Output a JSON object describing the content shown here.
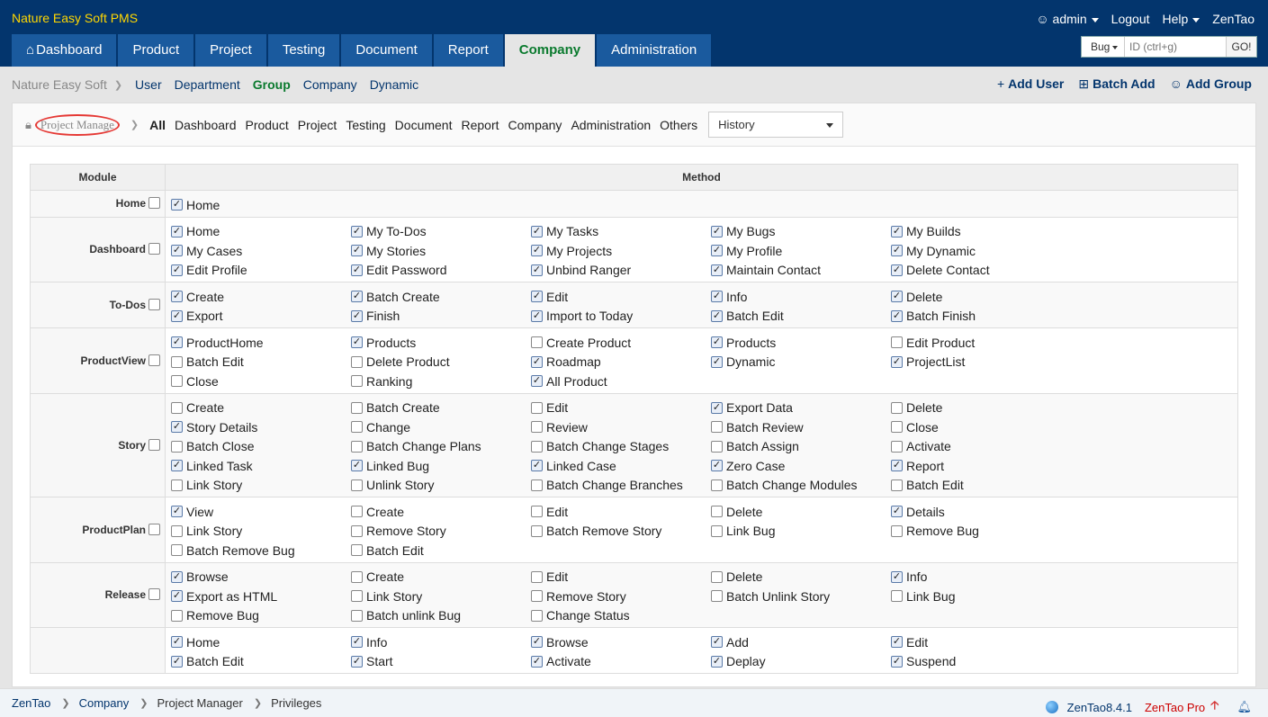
{
  "header": {
    "brand": "Nature Easy Soft PMS",
    "user": "admin",
    "logout": "Logout",
    "help": "Help",
    "zentao": "ZenTao"
  },
  "mainnav": [
    {
      "label": "Dashboard",
      "icon": "home-icon"
    },
    {
      "label": "Product"
    },
    {
      "label": "Project"
    },
    {
      "label": "Testing"
    },
    {
      "label": "Document"
    },
    {
      "label": "Report"
    },
    {
      "label": "Company",
      "active": true
    },
    {
      "label": "Administration"
    }
  ],
  "search": {
    "type": "Bug",
    "placeholder": "ID (ctrl+g)",
    "go": "GO!"
  },
  "subnav": {
    "crumb": "Nature Easy Soft",
    "links": [
      "User",
      "Department",
      "Group",
      "Company",
      "Dynamic"
    ],
    "active": "Group"
  },
  "actions": {
    "add_user": "Add User",
    "batch_add": "Batch Add",
    "add_group": "Add Group"
  },
  "filter": {
    "group_name": "Project Manage",
    "items": [
      "All",
      "Dashboard",
      "Product",
      "Project",
      "Testing",
      "Document",
      "Report",
      "Company",
      "Administration",
      "Others"
    ],
    "selected": "All",
    "history": "History"
  },
  "table": {
    "module_header": "Module",
    "method_header": "Method",
    "rows": [
      {
        "module": "Home",
        "items": [
          [
            "Home",
            true
          ]
        ]
      },
      {
        "module": "Dashboard",
        "items": [
          [
            "Home",
            true
          ],
          [
            "My To-Dos",
            true
          ],
          [
            "My Tasks",
            true
          ],
          [
            "My Bugs",
            true
          ],
          [
            "My Builds",
            true
          ],
          [
            "My Cases",
            true
          ],
          [
            "My Stories",
            true
          ],
          [
            "My Projects",
            true
          ],
          [
            "My Profile",
            true
          ],
          [
            "My Dynamic",
            true
          ],
          [
            "Edit Profile",
            true
          ],
          [
            "Edit Password",
            true
          ],
          [
            "Unbind Ranger",
            true
          ],
          [
            "Maintain Contact",
            true
          ],
          [
            "Delete Contact",
            true
          ]
        ]
      },
      {
        "module": "To-Dos",
        "items": [
          [
            "Create",
            true
          ],
          [
            "Batch Create",
            true
          ],
          [
            "Edit",
            true
          ],
          [
            "Info",
            true
          ],
          [
            "Delete",
            true
          ],
          [
            "Export",
            true
          ],
          [
            "Finish",
            true
          ],
          [
            "Import to Today",
            true
          ],
          [
            "Batch Edit",
            true
          ],
          [
            "Batch Finish",
            true
          ]
        ]
      },
      {
        "module": "ProductView",
        "items": [
          [
            "ProductHome",
            true
          ],
          [
            "Products",
            true
          ],
          [
            "Create Product",
            false
          ],
          [
            "Products",
            true
          ],
          [
            "Edit Product",
            false
          ],
          [
            "Batch Edit",
            false
          ],
          [
            "Delete Product",
            false
          ],
          [
            "Roadmap",
            true
          ],
          [
            "Dynamic",
            true
          ],
          [
            "ProjectList",
            true
          ],
          [
            "Close",
            false
          ],
          [
            "Ranking",
            false
          ],
          [
            "All Product",
            true
          ]
        ]
      },
      {
        "module": "Story",
        "items": [
          [
            "Create",
            false
          ],
          [
            "Batch Create",
            false
          ],
          [
            "Edit",
            false
          ],
          [
            "Export Data",
            true
          ],
          [
            "Delete",
            false
          ],
          [
            "Story Details",
            true
          ],
          [
            "Change",
            false
          ],
          [
            "Review",
            false
          ],
          [
            "Batch Review",
            false
          ],
          [
            "Close",
            false
          ],
          [
            "Batch Close",
            false
          ],
          [
            "Batch Change Plans",
            false
          ],
          [
            "Batch Change Stages",
            false
          ],
          [
            "Batch Assign",
            false
          ],
          [
            "Activate",
            false
          ],
          [
            "Linked Task",
            true
          ],
          [
            "Linked Bug",
            true
          ],
          [
            "Linked Case",
            true
          ],
          [
            "Zero Case",
            true
          ],
          [
            "Report",
            true
          ],
          [
            "Link Story",
            false
          ],
          [
            "Unlink Story",
            false
          ],
          [
            "Batch Change Branches",
            false
          ],
          [
            "Batch Change Modules",
            false
          ],
          [
            "Batch Edit",
            false
          ]
        ]
      },
      {
        "module": "ProductPlan",
        "items": [
          [
            "View",
            true
          ],
          [
            "Create",
            false
          ],
          [
            "Edit",
            false
          ],
          [
            "Delete",
            false
          ],
          [
            "Details",
            true
          ],
          [
            "Link Story",
            false
          ],
          [
            "Remove Story",
            false
          ],
          [
            "Batch Remove Story",
            false
          ],
          [
            "Link Bug",
            false
          ],
          [
            "Remove Bug",
            false
          ],
          [
            "Batch Remove Bug",
            false
          ],
          [
            "Batch Edit",
            false
          ]
        ]
      },
      {
        "module": "Release",
        "items": [
          [
            "Browse",
            true
          ],
          [
            "Create",
            false
          ],
          [
            "Edit",
            false
          ],
          [
            "Delete",
            false
          ],
          [
            "Info",
            true
          ],
          [
            "Export as HTML",
            true
          ],
          [
            "Link Story",
            false
          ],
          [
            "Remove Story",
            false
          ],
          [
            "Batch Unlink Story",
            false
          ],
          [
            "Link Bug",
            false
          ],
          [
            "Remove Bug",
            false
          ],
          [
            "Batch unlink Bug",
            false
          ],
          [
            "Change Status",
            false
          ]
        ]
      },
      {
        "module": "",
        "items": [
          [
            "Home",
            true
          ],
          [
            "Info",
            true
          ],
          [
            "Browse",
            true
          ],
          [
            "Add",
            true
          ],
          [
            "Edit",
            true
          ],
          [
            "Batch Edit",
            true
          ],
          [
            "Start",
            true
          ],
          [
            "Activate",
            true
          ],
          [
            "Deplay",
            true
          ],
          [
            "Suspend",
            true
          ]
        ]
      }
    ]
  },
  "footer": {
    "crumbs": [
      "ZenTao",
      "Company",
      "Project Manager",
      "Privileges"
    ],
    "version": "ZenTao8.4.1",
    "pro": "ZenTao Pro"
  }
}
